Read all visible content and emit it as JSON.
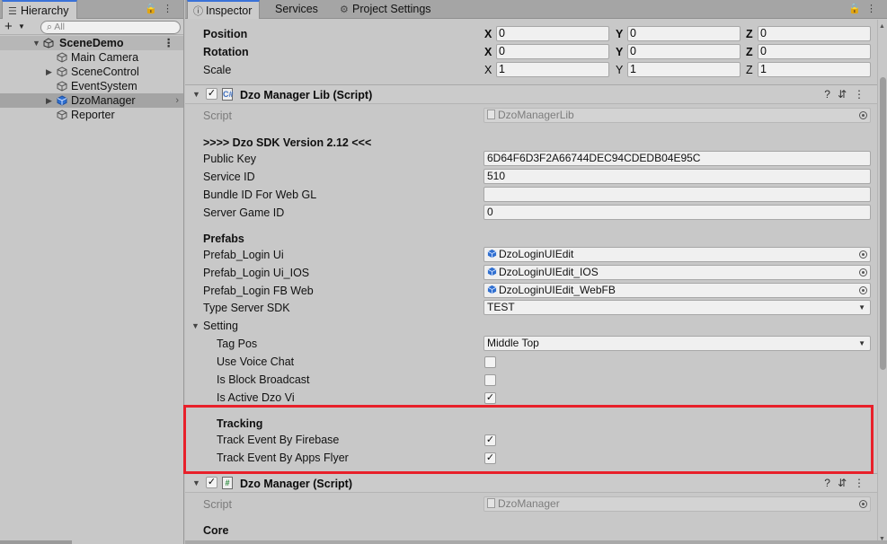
{
  "hierarchy": {
    "tab_label": "Hierarchy",
    "search_placeholder": "All",
    "scene": "SceneDemo",
    "items": [
      {
        "label": "Main Camera",
        "has_children": false
      },
      {
        "label": "SceneControl",
        "has_children": true
      },
      {
        "label": "EventSystem",
        "has_children": false
      },
      {
        "label": "DzoManager",
        "has_children": true,
        "selected": true
      },
      {
        "label": "Reporter",
        "has_children": false
      }
    ]
  },
  "inspector": {
    "tabs": [
      "Inspector",
      "Services",
      "Project Settings"
    ],
    "transform": {
      "position_label": "Position",
      "rotation_label": "Rotation",
      "scale_label": "Scale",
      "position": {
        "x": "0",
        "y": "0",
        "z": "0"
      },
      "rotation": {
        "x": "0",
        "y": "0",
        "z": "0"
      },
      "scale": {
        "x": "1",
        "y": "1",
        "z": "1"
      }
    },
    "dzo_lib": {
      "title": "Dzo Manager Lib (Script)",
      "script_label": "Script",
      "script_value": "DzoManagerLib",
      "sdk_version": ">>>> Dzo SDK Version 2.12 <<<",
      "public_key_label": "Public Key",
      "public_key": "6D64F6D3F2A66744DEC94CDEDB04E95C",
      "service_id_label": "Service ID",
      "service_id": "510",
      "bundle_id_label": "Bundle ID For Web GL",
      "bundle_id": "",
      "server_game_id_label": "Server Game ID",
      "server_game_id": "0",
      "prefabs_header": "Prefabs",
      "prefab_login_ui_label": "Prefab_Login Ui",
      "prefab_login_ui": "DzoLoginUIEdit",
      "prefab_login_ui_ios_label": "Prefab_Login Ui_IOS",
      "prefab_login_ui_ios": "DzoLoginUIEdit_IOS",
      "prefab_login_fb_label": "Prefab_Login FB Web",
      "prefab_login_fb": "DzoLoginUIEdit_WebFB",
      "type_server_label": "Type Server SDK",
      "type_server": "TEST",
      "setting_header": "Setting",
      "tag_pos_label": "Tag Pos",
      "tag_pos": "Middle Top",
      "use_voice_chat_label": "Use Voice Chat",
      "use_voice_chat": false,
      "is_block_broadcast_label": "Is Block Broadcast",
      "is_block_broadcast": false,
      "is_active_dzo_vi_label": "Is Active Dzo Vi",
      "is_active_dzo_vi": true,
      "tracking_header": "Tracking",
      "track_firebase_label": "Track Event By Firebase",
      "track_firebase": true,
      "track_appsflyer_label": "Track Event By Apps Flyer",
      "track_appsflyer": true
    },
    "dzo_manager": {
      "title": "Dzo Manager (Script)",
      "script_label": "Script",
      "script_value": "DzoManager",
      "core_header": "Core"
    }
  },
  "colors": {
    "highlight": "#e8202a",
    "tab_accent": "#3a72d8",
    "cube_blue": "#2f6fd0"
  },
  "icons": {
    "check": "✓"
  }
}
